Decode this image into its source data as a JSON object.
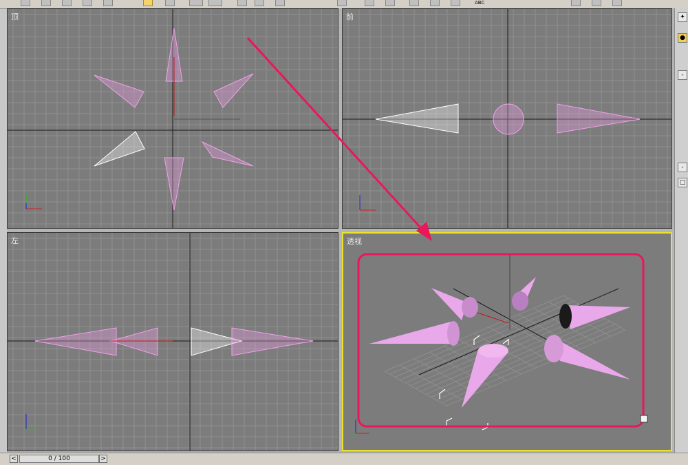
{
  "viewports": {
    "top": {
      "label": "顶"
    },
    "front": {
      "label": "前"
    },
    "left": {
      "label": "左"
    },
    "perspective": {
      "label": "透视"
    }
  },
  "timeline": {
    "frame": "0 / 100",
    "prev": "<",
    "next": ">"
  },
  "toolbar": {
    "abc": "ABC"
  },
  "colors": {
    "viewport_bg": "#7c7c7c",
    "object_pink": "#f0a0e8",
    "selected_white": "#ffffff",
    "active_border": "#e9e32b",
    "annotation": "#e8185a"
  },
  "icons": [
    "select-icon",
    "text-icon",
    "axis-tripod-icon",
    "arrow-annotation-icon"
  ]
}
